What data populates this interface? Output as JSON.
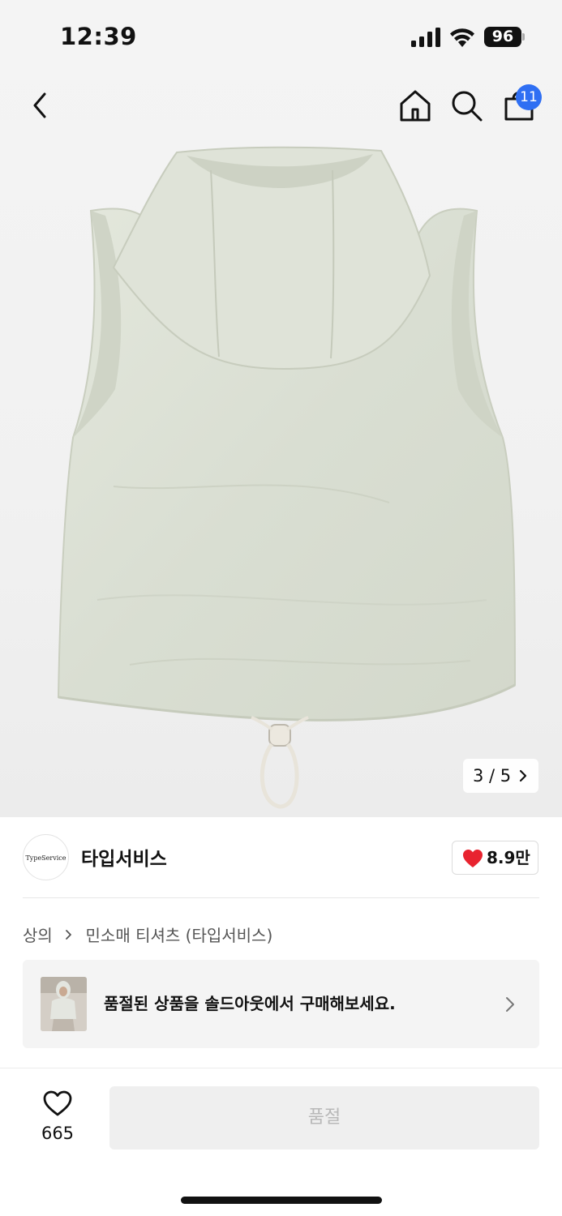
{
  "status_bar": {
    "time": "12:39",
    "battery": "96"
  },
  "top_nav": {
    "back_icon": "chevron-left-icon",
    "home_icon": "home-icon",
    "search_icon": "search-icon",
    "cart_icon": "shopping-bag-icon",
    "cart_count": "11"
  },
  "gallery": {
    "current": "3",
    "total": "5",
    "pager_text": "3 / 5",
    "product_color": "#dde2d6"
  },
  "brand": {
    "logo_text": "TypeService",
    "name": "타입서비스",
    "like_count": "8.9만",
    "heart_color": "#e8232f"
  },
  "breadcrumb": {
    "category": "상의",
    "subcategory": "민소매 티셔츠 (타입서비스)"
  },
  "soldout_banner": {
    "text": "품절된 상품을 솔드아웃에서 구매해보세요."
  },
  "bottom_bar": {
    "wish_count": "665",
    "buy_label": "품절"
  }
}
